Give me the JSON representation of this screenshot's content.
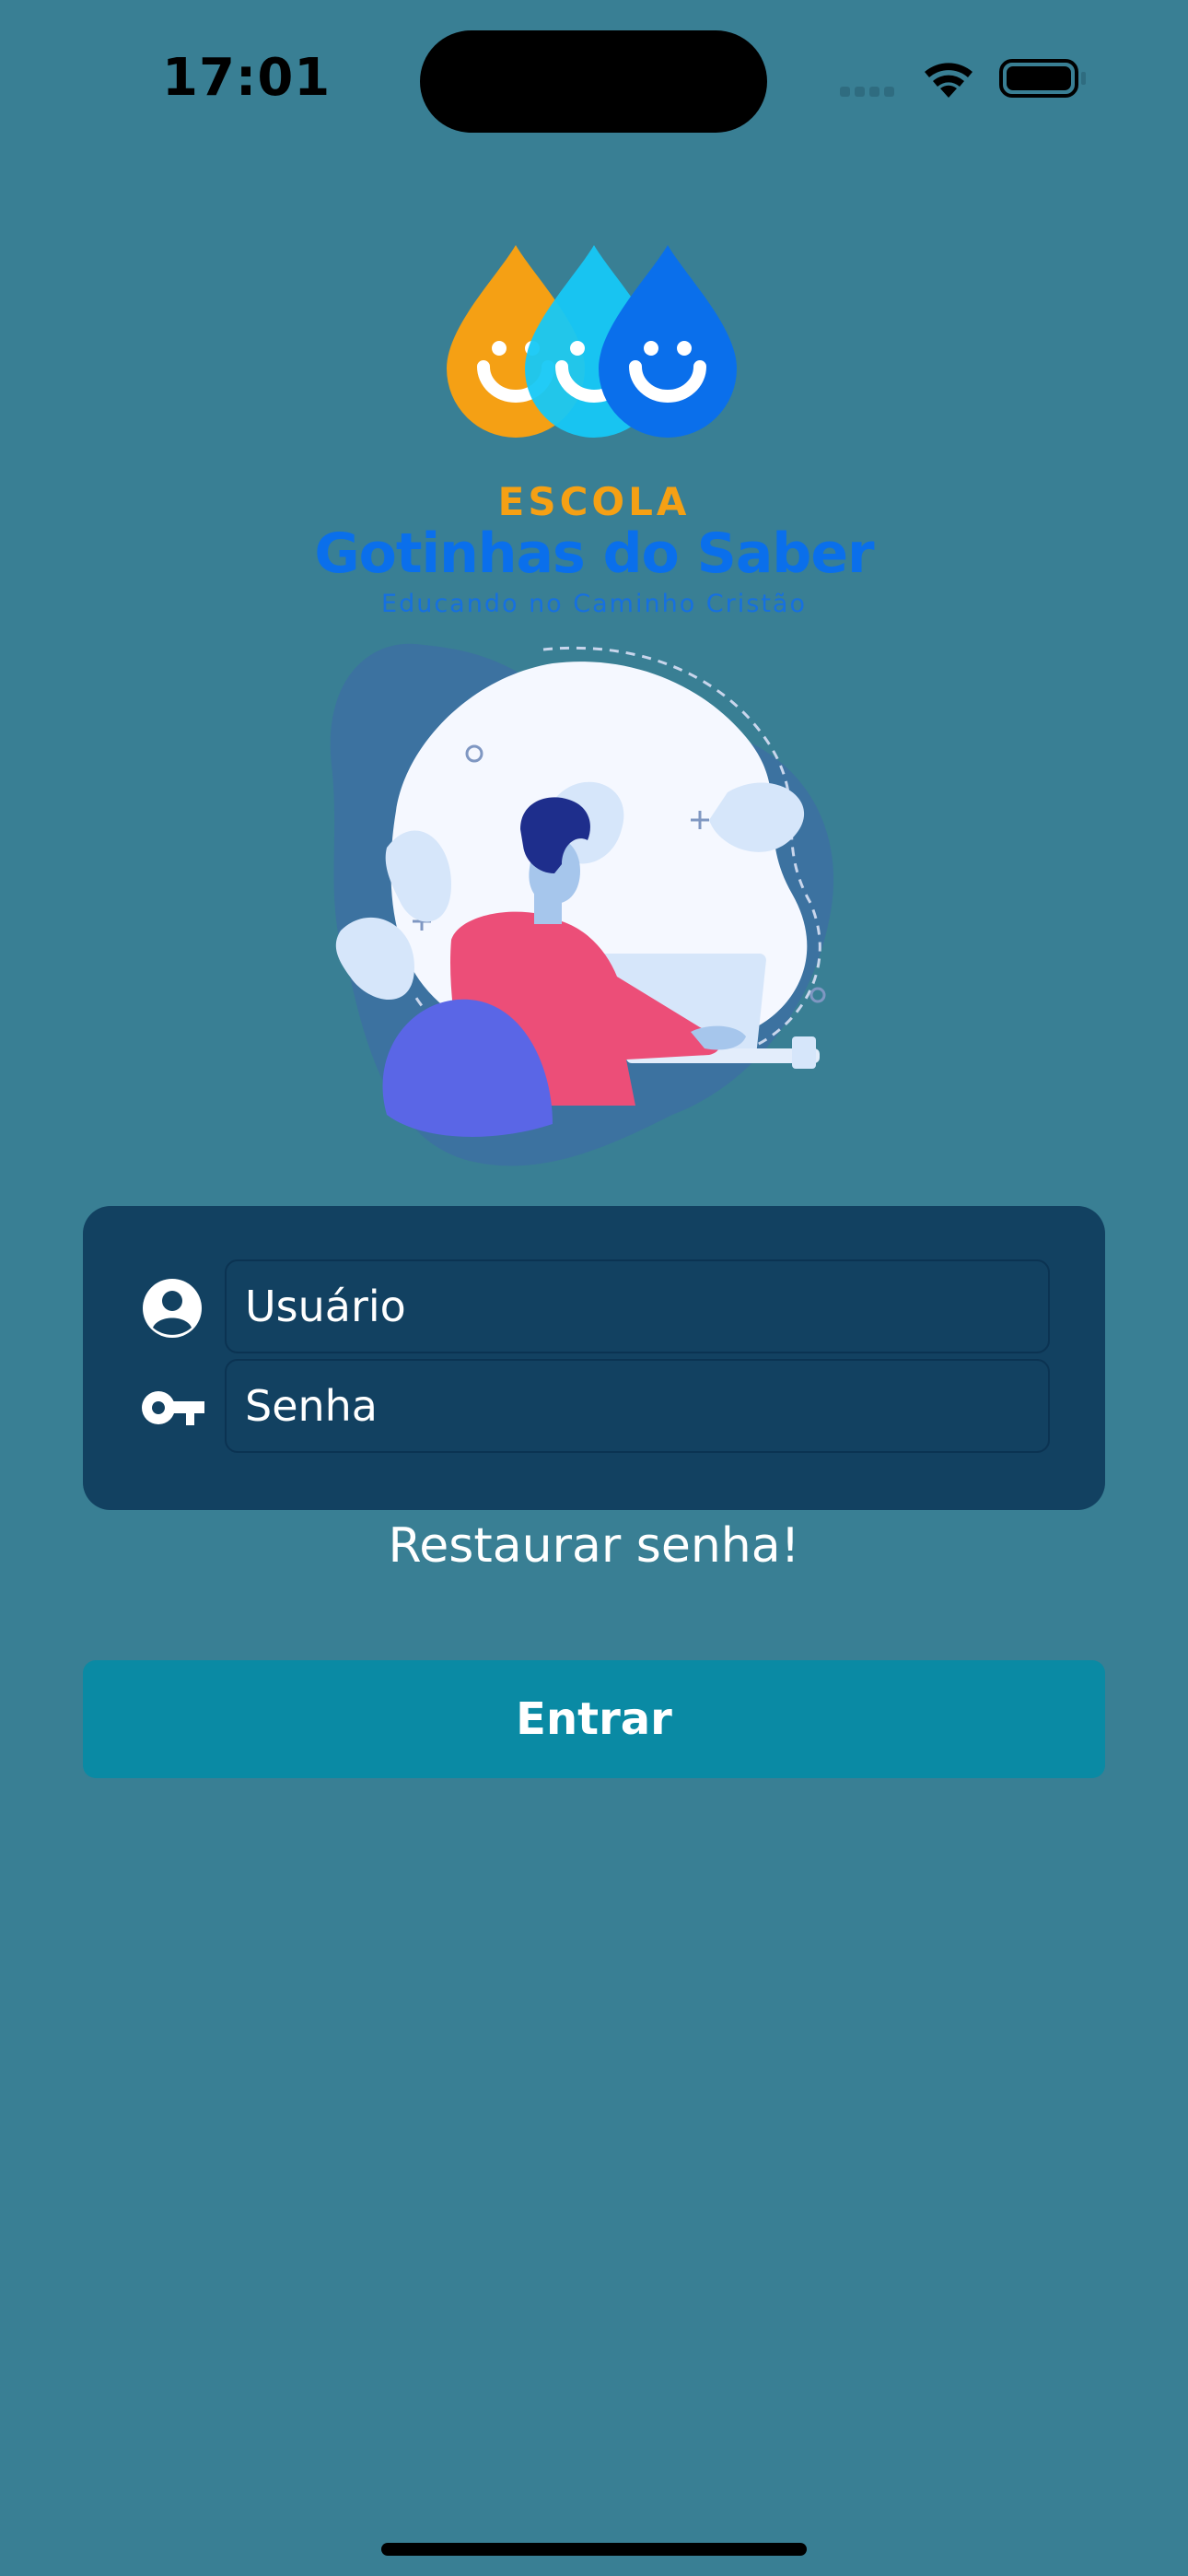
{
  "status_bar": {
    "time": "17:01",
    "icons": [
      "signal-icon",
      "wifi-icon",
      "battery-icon"
    ]
  },
  "logo": {
    "escola": "ESCOLA",
    "name": "Gotinhas do Saber",
    "tagline": "Educando no Caminho Cristão",
    "colors": {
      "orange": "#F5A014",
      "cyan": "#16C8F5",
      "blue": "#0A6FEB"
    }
  },
  "illustration": {
    "icon": "person-at-desk-illustration"
  },
  "form": {
    "username": {
      "icon": "user-circle-icon",
      "value": "",
      "placeholder": "Usuário"
    },
    "password": {
      "icon": "key-icon",
      "value": "",
      "placeholder": "Senha"
    },
    "restore_label": "Restaurar senha!",
    "submit_label": "Entrar"
  },
  "colors": {
    "background": "#397F94",
    "card": "#124161",
    "button": "#0A8AA4",
    "text": "#FFFFFF"
  }
}
